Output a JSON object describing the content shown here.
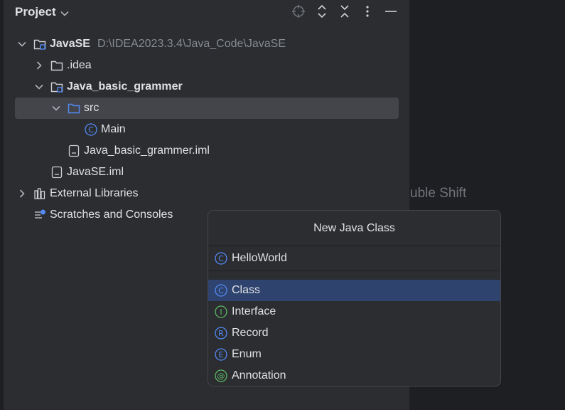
{
  "project_panel": {
    "title": "Project",
    "toolbar_icons": [
      "locate-icon",
      "expand-all-icon",
      "collapse-all-icon",
      "options-icon",
      "hide-icon"
    ]
  },
  "tree": {
    "root": {
      "label": "JavaSE",
      "path": "D:\\IDEA2023.3.4\\Java_Code\\JavaSE"
    },
    "idea": {
      "label": ".idea"
    },
    "module": {
      "label": "Java_basic_grammer"
    },
    "src": {
      "label": "src"
    },
    "main_class": {
      "label": "Main"
    },
    "module_iml": {
      "label": "Java_basic_grammer.iml"
    },
    "root_iml": {
      "label": "JavaSE.iml"
    },
    "external_libraries": {
      "label": "External Libraries"
    },
    "scratches": {
      "label": "Scratches and Consoles"
    }
  },
  "editor": {
    "hint": "uble Shift"
  },
  "dialog": {
    "title": "New Java Class",
    "input_value": "HelloWorld",
    "options": [
      {
        "label": "Class",
        "letter": "C",
        "color": "#548af7"
      },
      {
        "label": "Interface",
        "letter": "I",
        "color": "#5fb865"
      },
      {
        "label": "Record",
        "letter": "R",
        "color": "#548af7"
      },
      {
        "label": "Enum",
        "letter": "E",
        "color": "#548af7"
      },
      {
        "label": "Annotation",
        "letter": "@",
        "color": "#5fb865"
      }
    ]
  }
}
